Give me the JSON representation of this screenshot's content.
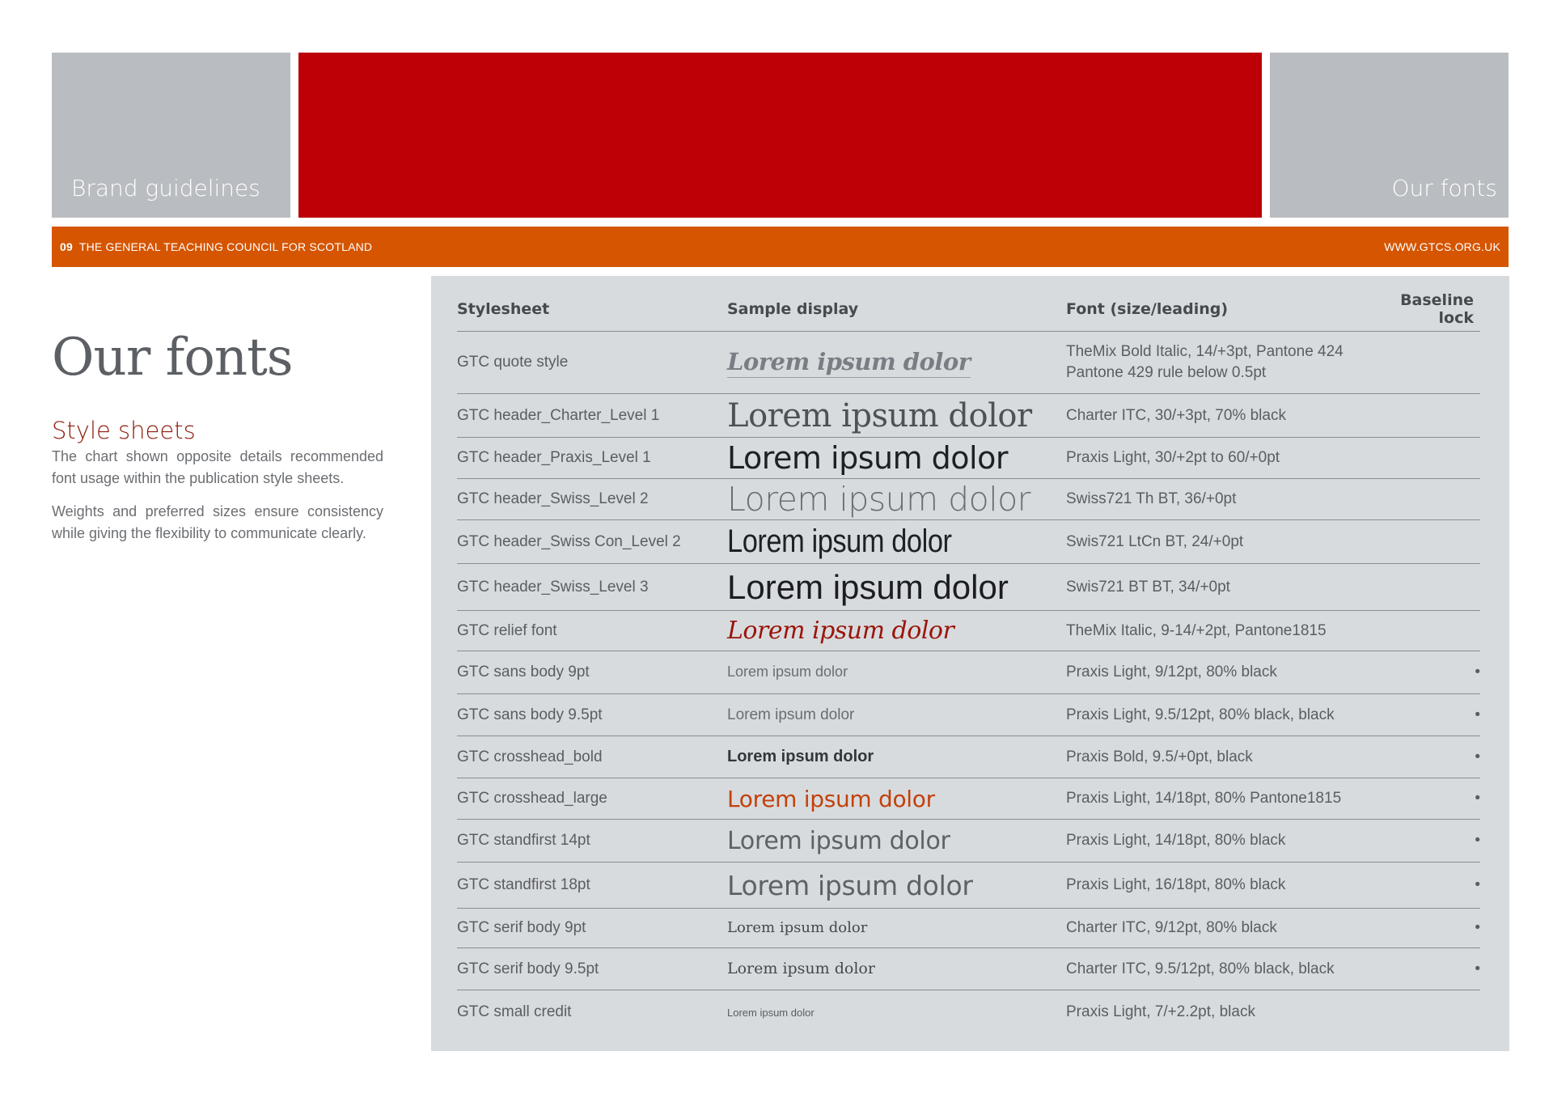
{
  "header": {
    "left_label": "Brand guidelines",
    "right_label": "Our fonts",
    "page_number": "09",
    "organisation": "THE GENERAL TEACHING COUNCIL FOR SCOTLAND",
    "website": "WWW.GTCS.ORG.UK"
  },
  "colors": {
    "red": "#bd0006",
    "orange": "#d55500",
    "grey": "#b9bcc0",
    "panel": "#d8dbde"
  },
  "intro": {
    "title": "Our fonts",
    "subtitle": "Style sheets",
    "paragraph_1": "The chart shown opposite details recommended font usage within the publication style sheets.",
    "paragraph_2": "Weights and preferred sizes ensure consistency while giving the flexibility to communicate clearly."
  },
  "table": {
    "headers": {
      "stylesheet": "Stylesheet",
      "sample": "Sample display",
      "font": "Font (size/leading)",
      "baseline": "Baseline lock"
    },
    "rows": [
      {
        "stylesheet": "GTC quote style",
        "sample": "Lorem ipsum dolor",
        "font": "TheMix Bold Italic, 14/+3pt, Pantone 424",
        "font_line2": "Pantone 429 rule below 0.5pt",
        "baseline": ""
      },
      {
        "stylesheet": "GTC header_Charter_Level 1",
        "sample": "Lorem ipsum dolor",
        "font": "Charter ITC, 30/+3pt, 70% black",
        "baseline": ""
      },
      {
        "stylesheet": "GTC header_Praxis_Level 1",
        "sample": "Lorem ipsum dolor",
        "font": "Praxis Light, 30/+2pt to 60/+0pt",
        "baseline": ""
      },
      {
        "stylesheet": "GTC header_Swiss_Level 2",
        "sample": "Lorem ipsum dolor",
        "font": "Swiss721 Th BT, 36/+0pt",
        "baseline": ""
      },
      {
        "stylesheet": "GTC header_Swiss Con_Level 2",
        "sample": "Lorem ipsum dolor",
        "font": "Swis721 LtCn BT, 24/+0pt",
        "baseline": ""
      },
      {
        "stylesheet": "GTC header_Swiss_Level 3",
        "sample": "Lorem ipsum dolor",
        "font": "Swis721 BT BT, 34/+0pt",
        "baseline": ""
      },
      {
        "stylesheet": "GTC relief font",
        "sample": "Lorem ipsum dolor",
        "font": "TheMix Italic, 9-14/+2pt, Pantone1815",
        "baseline": ""
      },
      {
        "stylesheet": "GTC sans body 9pt",
        "sample": "Lorem ipsum dolor",
        "font": "Praxis Light, 9/12pt, 80% black",
        "baseline": "•"
      },
      {
        "stylesheet": "GTC sans body 9.5pt",
        "sample": "Lorem ipsum dolor",
        "font": "Praxis Light, 9.5/12pt, 80% black, black",
        "baseline": "•"
      },
      {
        "stylesheet": "GTC crosshead_bold",
        "sample": "Lorem ipsum dolor",
        "font": "Praxis Bold, 9.5/+0pt, black",
        "baseline": "•"
      },
      {
        "stylesheet": "GTC crosshead_large",
        "sample": "Lorem ipsum dolor",
        "font": "Praxis Light, 14/18pt, 80% Pantone1815",
        "baseline": "•"
      },
      {
        "stylesheet": "GTC standfirst 14pt",
        "sample": "Lorem ipsum dolor",
        "font": "Praxis Light, 14/18pt, 80% black",
        "baseline": "•"
      },
      {
        "stylesheet": "GTC standfirst 18pt",
        "sample": "Lorem ipsum dolor",
        "font": "Praxis Light, 16/18pt, 80% black",
        "baseline": "•"
      },
      {
        "stylesheet": "GTC serif body 9pt",
        "sample": "Lorem ipsum dolor",
        "font": "Charter ITC, 9/12pt, 80% black",
        "baseline": "•"
      },
      {
        "stylesheet": "GTC serif body 9.5pt",
        "sample": "Lorem ipsum dolor",
        "font": "Charter ITC, 9.5/12pt, 80% black, black",
        "baseline": "•"
      },
      {
        "stylesheet": "GTC small credit",
        "sample": "Lorem ipsum dolor",
        "font": "Praxis Light, 7/+2.2pt, black",
        "baseline": ""
      }
    ]
  }
}
